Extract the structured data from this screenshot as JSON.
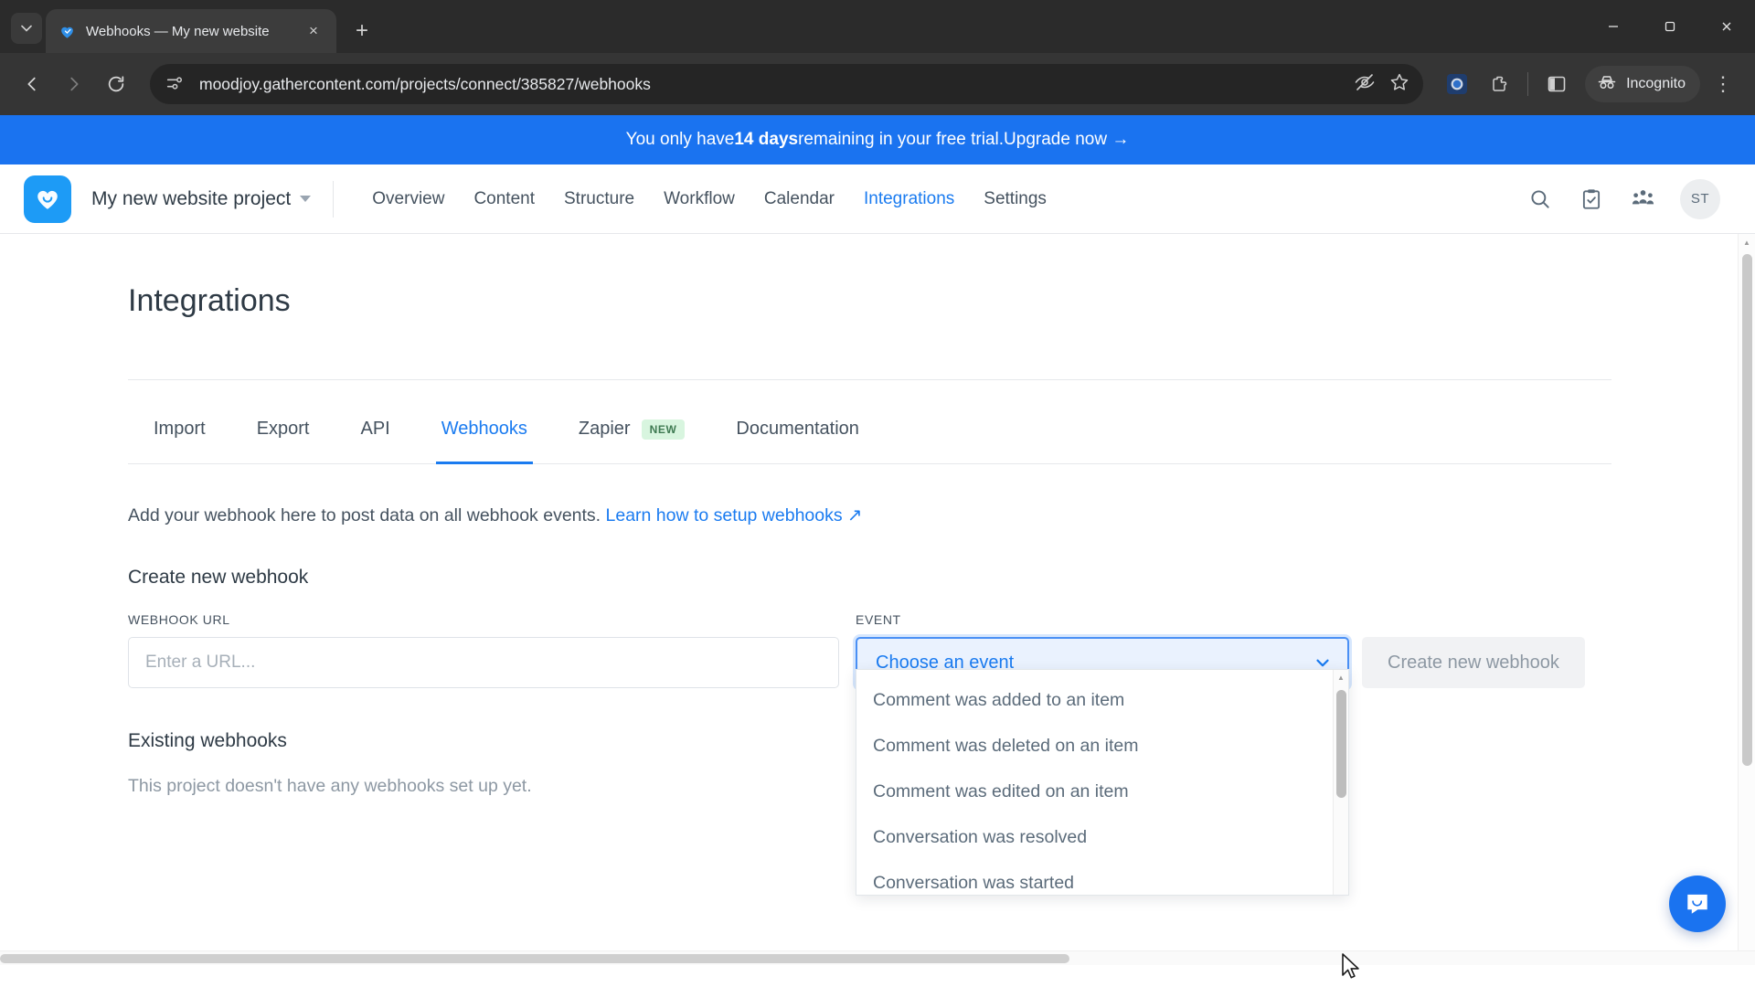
{
  "browser": {
    "tab": {
      "title": "Webhooks — My new website ",
      "favicon_name": "gathercontent-favicon",
      "close_label": "×"
    },
    "new_tab_label": "+",
    "tab_list_label": "⌄",
    "window_controls": {
      "minimize": "—",
      "maximize": "▢",
      "close": "✕"
    },
    "nav": {
      "back": "←",
      "forward": "→",
      "reload": "⟳"
    },
    "omnibox": {
      "url": "moodjoy.gathercontent.com/projects/connect/385827/webhooks",
      "site_info_icon": "site-settings-icon",
      "tracking_protection_icon": "eye-slash-icon",
      "bookmark_icon": "star-icon"
    },
    "toolbar_icons": [
      "profile-icon",
      "extensions-icon",
      "side-panel-icon"
    ],
    "incognito_label": "Incognito",
    "menu_label": "⋮"
  },
  "trial": {
    "prefix": "You only have ",
    "days": "14 days",
    "suffix": " remaining in your free trial. ",
    "cta": "Upgrade now →"
  },
  "header": {
    "logo_name": "gathercontent-logo",
    "project_name": "My new website project",
    "nav": [
      {
        "label": "Overview",
        "active": false
      },
      {
        "label": "Content",
        "active": false
      },
      {
        "label": "Structure",
        "active": false
      },
      {
        "label": "Workflow",
        "active": false
      },
      {
        "label": "Calendar",
        "active": false
      },
      {
        "label": "Integrations",
        "active": true
      },
      {
        "label": "Settings",
        "active": false
      }
    ],
    "icons": [
      "search-icon",
      "tasks-clipboard-icon",
      "team-people-icon"
    ],
    "avatar_initials": "ST"
  },
  "page": {
    "title": "Integrations",
    "tabs": [
      {
        "label": "Import",
        "active": false,
        "badge": null
      },
      {
        "label": "Export",
        "active": false,
        "badge": null
      },
      {
        "label": "API",
        "active": false,
        "badge": null
      },
      {
        "label": "Webhooks",
        "active": true,
        "badge": null
      },
      {
        "label": "Zapier",
        "active": false,
        "badge": "NEW"
      },
      {
        "label": "Documentation",
        "active": false,
        "badge": null
      }
    ],
    "description": "Add your webhook here to post data on all webhook events. ",
    "description_link": "Learn how to setup webhooks ↗",
    "create_section_title": "Create new webhook",
    "webhook_url_label": "WEBHOOK URL",
    "webhook_url_placeholder": "Enter a URL...",
    "webhook_url_value": "",
    "event_label": "EVENT",
    "event_selected": "Choose an event",
    "event_options": [
      "Comment was added to an item",
      "Comment was deleted on an item",
      "Comment was edited on an item",
      "Conversation was resolved",
      "Conversation was started"
    ],
    "create_button": "Create new webhook",
    "existing_title": "Existing webhooks",
    "existing_empty": "This project doesn't have any webhooks set up yet."
  },
  "widgets": {
    "intercom_name": "intercom-messenger-button"
  },
  "colors": {
    "accent_blue": "#1a7bf0",
    "banner_blue": "#1a73f0",
    "logo_blue": "#1d9bf6",
    "badge_green_bg": "#d8f5df",
    "badge_green_text": "#3f7a52",
    "text_dark": "#2e3a45",
    "text_muted": "#8d98a3"
  }
}
